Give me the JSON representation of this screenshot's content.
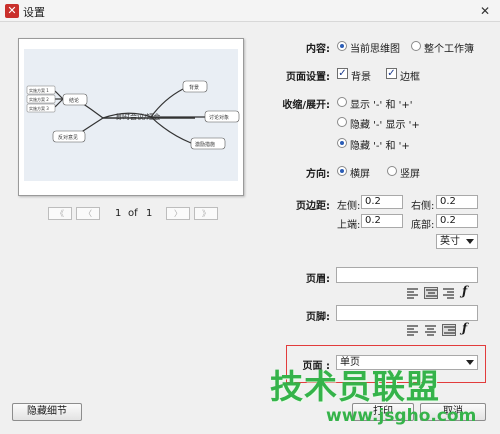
{
  "window": {
    "title": "设置"
  },
  "preview": {
    "map": {
      "center": "即时会议/短会",
      "nodes": [
        "结论",
        "反对意见",
        "背景",
        "讨论对象",
        "激励措施"
      ],
      "subnodes": [
        "实施方案 1",
        "实施方案 2",
        "实施方案 3"
      ]
    }
  },
  "pager": {
    "first": "《",
    "prev": "〈",
    "next": "〉",
    "last": "》",
    "current": "1",
    "of": "of",
    "total": "1"
  },
  "content": {
    "label": "内容:",
    "opt1": "当前思维图",
    "opt2": "整个工作簿"
  },
  "page_setup": {
    "label": "页面设置:",
    "opt1": "背景",
    "opt2": "边框"
  },
  "collapse": {
    "label": "收缩/展开:",
    "opt1": "显示 '-' 和 '+'",
    "opt2": "隐藏 '-' 显示 '+",
    "opt3": "隐藏 '-' 和 '+"
  },
  "orientation": {
    "label": "方向:",
    "opt1": "横屏",
    "opt2": "竖屏"
  },
  "margins": {
    "label": "页边距:",
    "left_label": "左侧:",
    "left": "0.2",
    "right_label": "右侧:",
    "right": "0.2",
    "top_label": "上端:",
    "top": "0.2",
    "bottom_label": "底部:",
    "bottom": "0.2",
    "unit": "英寸"
  },
  "header": {
    "label": "页眉:",
    "value": ""
  },
  "footer": {
    "label": "页脚:",
    "value": ""
  },
  "pages": {
    "label": "页面 :",
    "value": "单页"
  },
  "buttons": {
    "hide_details": "隐藏细节",
    "print": "打印",
    "cancel": "取消"
  },
  "watermark": {
    "main": "技术员联盟",
    "url": "www.jsgho.com"
  }
}
